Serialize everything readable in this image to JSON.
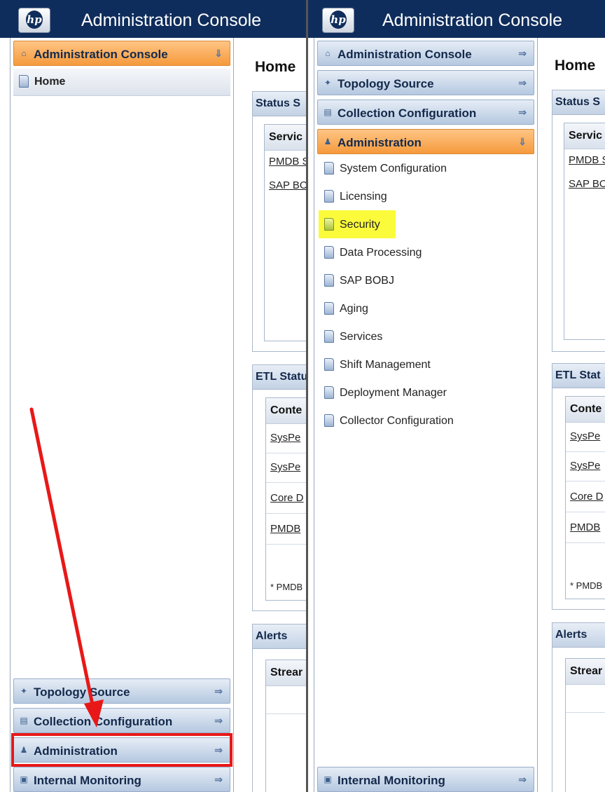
{
  "app": {
    "title": "Administration Console",
    "logo_text": "hp"
  },
  "left_panel": {
    "nav": {
      "header_top": {
        "label": "Administration Console",
        "icon": "home-icon"
      },
      "home_item": {
        "label": "Home"
      },
      "bottom_headers": [
        {
          "label": "Topology Source",
          "icon": "topology-icon"
        },
        {
          "label": "Collection Configuration",
          "icon": "collection-icon"
        },
        {
          "label": "Administration",
          "icon": "admin-icon"
        },
        {
          "label": "Internal Monitoring",
          "icon": "monitor-icon"
        }
      ]
    },
    "content": {
      "page_title": "Home",
      "status_section": {
        "title": "Status S",
        "column": "Servic",
        "rows": [
          "PMDB S",
          "SAP BO"
        ]
      },
      "etl_section": {
        "title": "ETL Statu",
        "column": "Conte",
        "rows": [
          "SysPe",
          "SysPe",
          "Core D",
          "PMDB"
        ],
        "footnote": "* PMDB"
      },
      "alerts_section": {
        "title": "Alerts",
        "column": "Strear"
      }
    }
  },
  "right_panel": {
    "nav": {
      "headers": [
        {
          "label": "Administration Console",
          "icon": "home-icon"
        },
        {
          "label": "Topology Source",
          "icon": "topology-icon"
        },
        {
          "label": "Collection Configuration",
          "icon": "collection-icon"
        },
        {
          "label": "Administration",
          "icon": "admin-icon"
        }
      ],
      "items": [
        "System Configuration",
        "Licensing",
        "Security",
        "Data Processing",
        "SAP BOBJ",
        "Aging",
        "Services",
        "Shift Management",
        "Deployment Manager",
        "Collector Configuration"
      ],
      "highlighted_item": "Security",
      "bottom_header": {
        "label": "Internal Monitoring",
        "icon": "monitor-icon"
      }
    },
    "content": {
      "page_title": "Home",
      "status_section": {
        "title": "Status S",
        "column": "Servic",
        "rows": [
          "PMDB S",
          "SAP BO"
        ]
      },
      "etl_section": {
        "title": "ETL Stat",
        "column": "Conte",
        "rows": [
          "SysPe",
          "SysPe",
          "Core D",
          "PMDB"
        ],
        "footnote": "* PMDB"
      },
      "alerts_section": {
        "title": "Alerts",
        "column": "Strear"
      }
    }
  },
  "colors": {
    "title_bar": "#0f2d5c",
    "active_header": "#f59a3c",
    "highlight": "#fbfb3c",
    "annotation": "#e81818"
  }
}
